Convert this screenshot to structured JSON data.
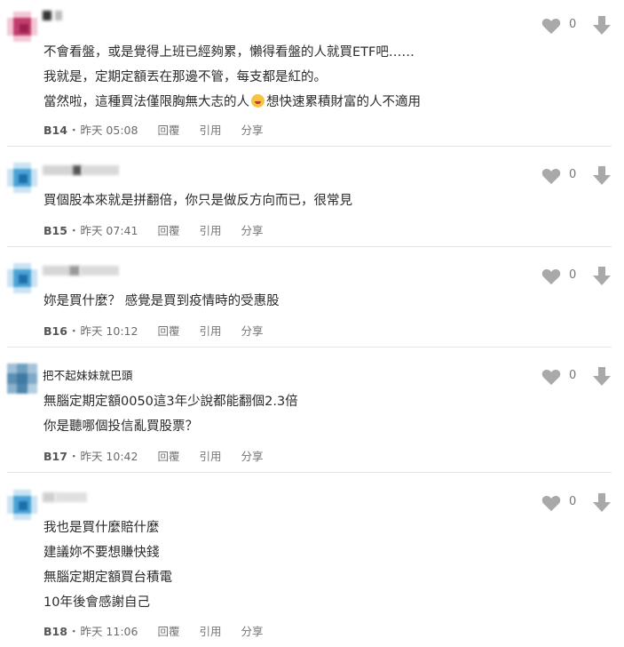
{
  "colors": {
    "text": "#2b2b2b",
    "meta": "#6b6b6b",
    "icon": "#a9a9a9",
    "divider": "#e3e3e3"
  },
  "icons": {
    "like": "heart-icon",
    "dislike": "arrow-down-icon"
  },
  "comments": [
    {
      "author": "",
      "lines": [
        "不會看盤，或是覺得上班已經夠累，懶得看盤的人就買ETF吧……",
        "我就是，定期定額丟在那邊不管，每支都是紅的。",
        "當然啦，這種買法僅限胸無大志的人",
        "想快速累積財富的人不適用"
      ],
      "floor": "B14",
      "time": "昨天 05:08",
      "reply": "回覆",
      "quote": "引用",
      "share": "分享",
      "likes": "0"
    },
    {
      "author": "",
      "lines": [
        "買個股本來就是拼翻倍，你只是做反方向而已，很常見"
      ],
      "floor": "B15",
      "time": "昨天 07:41",
      "reply": "回覆",
      "quote": "引用",
      "share": "分享",
      "likes": "0"
    },
    {
      "author": "",
      "lines": [
        "妳是買什麼？ 感覺是買到疫情時的受惠股"
      ],
      "floor": "B16",
      "time": "昨天 10:12",
      "reply": "回覆",
      "quote": "引用",
      "share": "分享",
      "likes": "0"
    },
    {
      "author": "把不起妹妹就巴頭",
      "lines": [
        "無腦定期定額0050這3年少說都能翻個2.3倍",
        "你是聽哪個投信亂買股票？"
      ],
      "floor": "B17",
      "time": "昨天 10:42",
      "reply": "回覆",
      "quote": "引用",
      "share": "分享",
      "likes": "0"
    },
    {
      "author": "",
      "lines": [
        "我也是買什麼賠什麼",
        "建議妳不要想賺快錢",
        "無腦定期定額買台積電",
        "10年後會感謝自己"
      ],
      "floor": "B18",
      "time": "昨天 11:06",
      "reply": "回覆",
      "quote": "引用",
      "share": "分享",
      "likes": "0"
    }
  ]
}
